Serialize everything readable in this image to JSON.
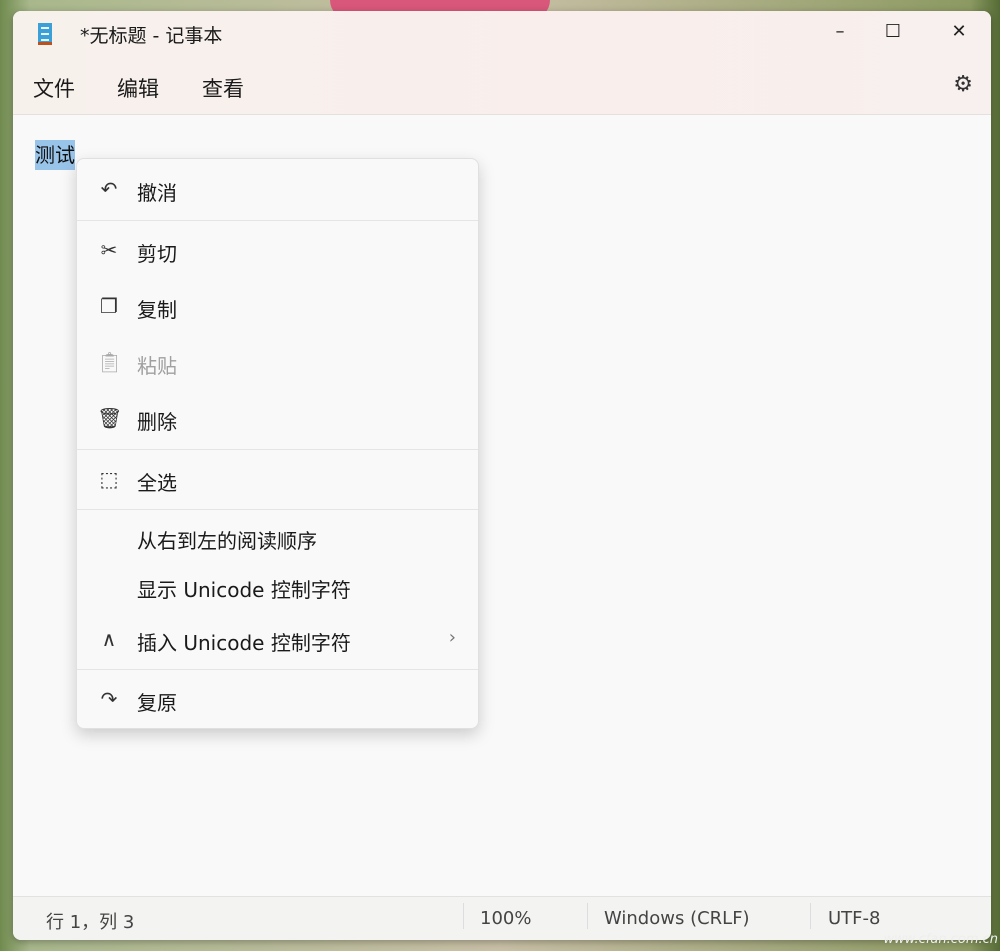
{
  "window": {
    "title": "*无标题 - 记事本",
    "minimize": "–",
    "maximize": "☐",
    "close": "✕"
  },
  "menu": {
    "file": "文件",
    "edit": "编辑",
    "view": "查看",
    "settings_icon": "gear-icon"
  },
  "editor": {
    "text": "测试"
  },
  "context_menu": {
    "undo": "撤消",
    "cut": "剪切",
    "copy": "复制",
    "paste": "粘贴",
    "delete": "删除",
    "select_all": "全选",
    "rtl": "从右到左的阅读顺序",
    "show_unicode": "显示 Unicode 控制字符",
    "insert_unicode": "插入 Unicode 控制字符",
    "redo": "复原"
  },
  "status": {
    "position": "行 1，列 3",
    "zoom": "100%",
    "line_ending": "Windows (CRLF)",
    "encoding": "UTF-8"
  },
  "watermark": "www.cfan.com.cn"
}
